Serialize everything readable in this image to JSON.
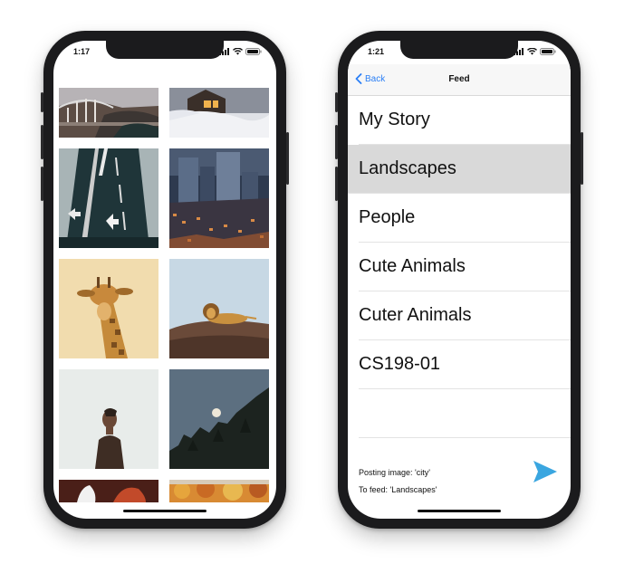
{
  "left_phone": {
    "status": {
      "time": "1:17"
    },
    "photos": [
      "bridge-coast-photo",
      "snowy-cabin-photo",
      "highway-overhead-photo",
      "city-skyline-photo",
      "giraffe-photo",
      "lion-on-rock-photo",
      "man-silhouette-photo",
      "moon-forest-photo",
      "red-animal-photo",
      "autumn-trees-photo"
    ]
  },
  "right_phone": {
    "status": {
      "time": "1:21"
    },
    "nav": {
      "back_label": "Back",
      "title": "Feed"
    },
    "feeds": [
      {
        "label": "My Story",
        "selected": false
      },
      {
        "label": "Landscapes",
        "selected": true
      },
      {
        "label": "People",
        "selected": false
      },
      {
        "label": "Cute Animals",
        "selected": false
      },
      {
        "label": "Cuter Animals",
        "selected": false
      },
      {
        "label": "CS198-01",
        "selected": false
      }
    ],
    "posting_image": "Posting image: 'city'",
    "to_feed": "To feed: 'Landscapes'",
    "accent_color": "#2a7ff6",
    "send_color": "#3aa6e0"
  }
}
